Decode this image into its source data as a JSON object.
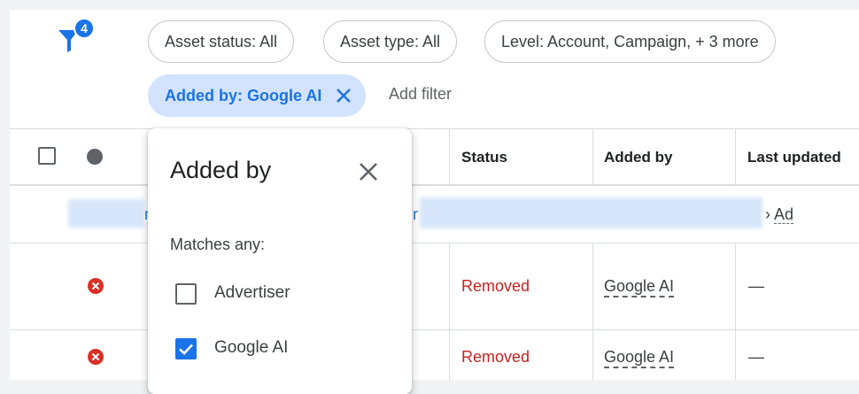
{
  "filters": {
    "count_badge": "4",
    "chips": [
      {
        "label": "Asset status: All"
      },
      {
        "label": "Asset type: All"
      },
      {
        "label": "Level: Account, Campaign, + 3 more"
      }
    ],
    "active_chip": {
      "label": "Added by: Google AI"
    },
    "add_filter_label": "Add filter"
  },
  "table": {
    "headers": {
      "status": "Status",
      "added_by": "Added by",
      "last_updated": "Last updated"
    },
    "group_row": {
      "link_fragment_1": "n",
      "link_fragment_2": "r",
      "breadcrumb_sep": "›",
      "breadcrumb_link": "Ad"
    },
    "rows": [
      {
        "status": "Removed",
        "added_by": "Google AI",
        "last_updated": "—"
      },
      {
        "status": "Removed",
        "added_by": "Google AI",
        "last_updated": "—"
      }
    ]
  },
  "popup": {
    "title": "Added by",
    "subtitle": "Matches any:",
    "options": [
      {
        "label": "Advertiser",
        "checked": false
      },
      {
        "label": "Google AI",
        "checked": true
      }
    ]
  },
  "colors": {
    "accent": "#1a73e8",
    "active_chip_bg": "#d3e3fd",
    "error": "#c5221f"
  }
}
